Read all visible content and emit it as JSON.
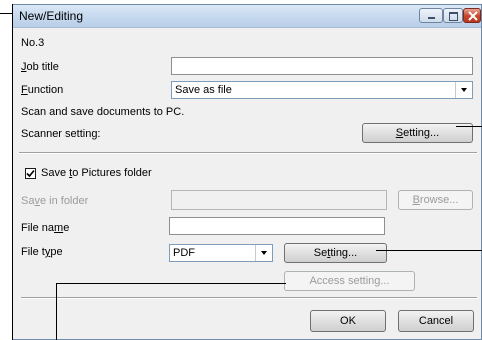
{
  "window": {
    "title": "New/Editing"
  },
  "form": {
    "number": "No.3",
    "job_title_label_prefix": "",
    "job_title_label_u": "J",
    "job_title_label_rest": "ob title",
    "job_title_value": "",
    "function_label_u": "F",
    "function_label_rest": "unction",
    "function_value": "Save as file",
    "description": "Scan and save documents to PC.",
    "scanner_setting_label": "Scanner setting:",
    "scanner_setting_button_u": "S",
    "scanner_setting_button_rest": "etting...",
    "save_to_pictures_pre": "Save ",
    "save_to_pictures_u": "t",
    "save_to_pictures_rest": "o Pictures folder",
    "save_to_pictures_checked": true,
    "save_in_folder_pre": "Sa",
    "save_in_folder_u": "v",
    "save_in_folder_rest": "e in folder",
    "save_in_folder_value": "",
    "browse_button_u": "B",
    "browse_button_rest": "rowse...",
    "file_name_pre": "File na",
    "file_name_u": "m",
    "file_name_rest": "e",
    "file_name_value": "",
    "file_type_pre": "File t",
    "file_type_u": "y",
    "file_type_rest": "pe",
    "file_type_value": "PDF",
    "file_setting_pre": "Se",
    "file_setting_u": "t",
    "file_setting_rest": "ting...",
    "access_setting_button": "Access setting..."
  },
  "footer": {
    "ok_label": "OK",
    "cancel_label": "Cancel"
  },
  "colors": {
    "titlebar": "#c5d8ee",
    "dialog_bg": "#f0f0f0",
    "close_button": "#c8442a",
    "disabled_text": "#9b9b9b"
  }
}
